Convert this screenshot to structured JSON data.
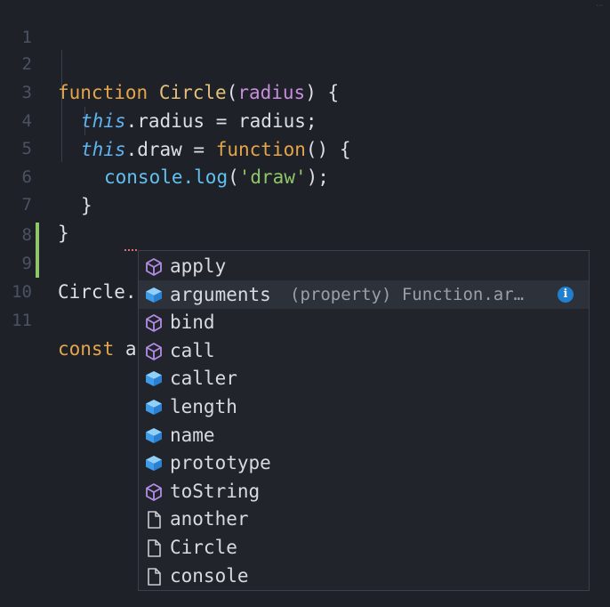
{
  "line_numbers": [
    "1",
    "2",
    "3",
    "4",
    "5",
    "6",
    "7",
    "8",
    "9",
    "10",
    "11"
  ],
  "code": {
    "l2": {
      "kw": "function",
      "name": "Circle",
      "open": "(",
      "param": "radius",
      "close": ") {"
    },
    "l3": {
      "this": "this",
      "rest": ".radius = radius;"
    },
    "l4": {
      "this": "this",
      "mid": ".draw = ",
      "kw": "function",
      "rest": "() {"
    },
    "l5": {
      "obj": "console.",
      "fn": "log",
      "open": "(",
      "str": "'draw'",
      "close": ");"
    },
    "l6": "}",
    "l7": "}",
    "l9": "Circle.",
    "l11": {
      "kw": "const",
      "rest": " a"
    }
  },
  "suggestions": {
    "items": [
      {
        "label": "apply",
        "icon": "method-icon"
      },
      {
        "label": "arguments",
        "icon": "property-icon",
        "detail": "(property) Function.ar…",
        "selected": true
      },
      {
        "label": "bind",
        "icon": "method-icon"
      },
      {
        "label": "call",
        "icon": "method-icon"
      },
      {
        "label": "caller",
        "icon": "property-icon"
      },
      {
        "label": "length",
        "icon": "property-icon"
      },
      {
        "label": "name",
        "icon": "property-icon"
      },
      {
        "label": "prototype",
        "icon": "property-icon"
      },
      {
        "label": "toString",
        "icon": "method-icon"
      },
      {
        "label": "another",
        "icon": "text-icon"
      },
      {
        "label": "Circle",
        "icon": "text-icon"
      },
      {
        "label": "console",
        "icon": "text-icon"
      }
    ],
    "info_glyph": "i"
  },
  "colors": {
    "keyword": "#e5a54b",
    "this": "#5fb3f0",
    "param": "#c88dde",
    "function": "#61c0ef",
    "string": "#8fc66a",
    "method_icon": "#b38ce6",
    "property_icon": "#4fb3f6",
    "modified_gutter": "#8fc66a"
  }
}
